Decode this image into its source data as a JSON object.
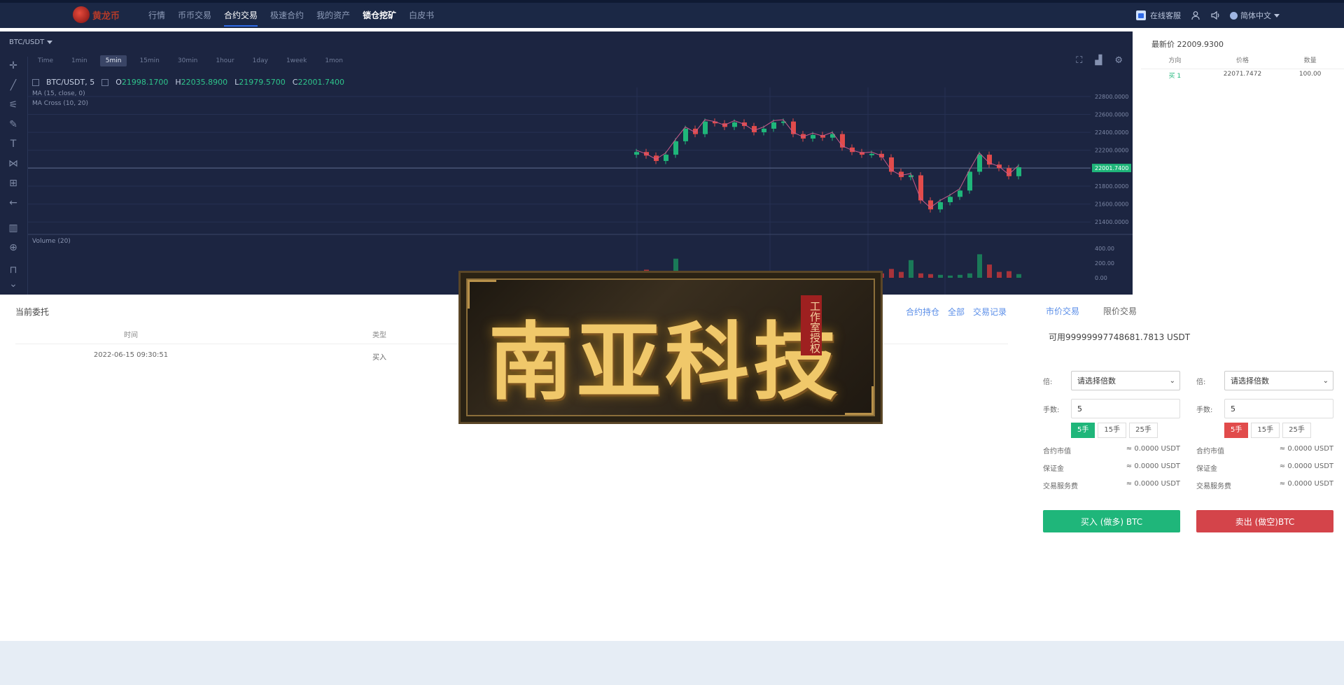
{
  "header": {
    "logo_text": "黄龙币",
    "nav": [
      "行情",
      "币币交易",
      "合约交易",
      "极速合约",
      "我的资产",
      "锁仓挖矿",
      "白皮书"
    ],
    "active_nav": "合约交易",
    "right": {
      "service": "在线客服",
      "language": "简体中文"
    }
  },
  "chart": {
    "pair": "BTC/USDT",
    "intervals": [
      "Time",
      "1min",
      "5min",
      "15min",
      "30min",
      "1hour",
      "1day",
      "1week",
      "1mon"
    ],
    "active_interval": "5min",
    "ohlc_title": "BTC/USDT, 5",
    "o": "21998.1700",
    "h": "22035.8900",
    "l": "21979.5700",
    "c": "22001.7400",
    "ind1": "MA (15, close, 0)",
    "ind2": "MA Cross (10, 20)",
    "vol_label": "Volume (20)"
  },
  "chart_data": {
    "type": "line",
    "title": "BTC/USDT, 5",
    "y_ticks": [
      "22800.0000",
      "22600.0000",
      "22400.0000",
      "22200.0000",
      "22000.0000",
      "21800.0000",
      "21600.0000",
      "21400.0000"
    ],
    "current_price": "22001.7400",
    "vol_ticks": [
      "400.00",
      "200.00",
      "0.00"
    ],
    "x": [
      1,
      2,
      3,
      4,
      5,
      6,
      7,
      8,
      9,
      10,
      11,
      12,
      13,
      14,
      15,
      16,
      17,
      18,
      19,
      20,
      21,
      22,
      23,
      24,
      25,
      26,
      27,
      28,
      29,
      30,
      31,
      32,
      33,
      34,
      35,
      36,
      37,
      38,
      39,
      40
    ],
    "series": [
      {
        "values": [
          22180,
          22140,
          22080,
          22150,
          22300,
          22440,
          22380,
          22520,
          22500,
          22460,
          22510,
          22470,
          22400,
          22440,
          22510,
          22520,
          22380,
          22330,
          22370,
          22340,
          22380,
          22230,
          22180,
          22150,
          22160,
          22120,
          21960,
          21900,
          21920,
          21640,
          21540,
          21620,
          21680,
          21750,
          21960,
          22150,
          22040,
          22000,
          21910,
          22010
        ]
      }
    ],
    "volume": [
      60,
      110,
      40,
      30,
      260,
      40,
      50,
      60,
      30,
      40,
      70,
      50,
      40,
      30,
      60,
      45,
      40,
      50,
      35,
      60,
      30,
      70,
      40,
      50,
      30,
      60,
      120,
      80,
      240,
      60,
      50,
      40,
      30,
      40,
      60,
      320,
      180,
      80,
      90,
      50
    ]
  },
  "orderbook": {
    "latest": "最新价 22009.9300",
    "headers": [
      "方向",
      "价格",
      "数量"
    ],
    "rows": [
      {
        "dir": "买 1",
        "price": "22071.7472",
        "qty": "100.00"
      }
    ]
  },
  "orders": {
    "title": "当前委托",
    "links": [
      "合约持仓",
      "全部",
      "交易记录"
    ],
    "headers": [
      "时间",
      "类型"
    ],
    "rows": [
      {
        "time": "2022-06-15 09:30:51",
        "type": "买入"
      }
    ]
  },
  "trade": {
    "tabs": [
      "市价交易",
      "限价交易"
    ],
    "available": "可用99999997748681.7813 USDT",
    "leverage_label": "倍:",
    "leverage_placeholder": "请选择倍数",
    "qty_label": "手数:",
    "qty_value": "5",
    "lots": [
      "5手",
      "15手",
      "25手"
    ],
    "contract_value_label": "合约市值",
    "contract_value": "≈ 0.0000 USDT",
    "margin_label": "保证金",
    "margin": "≈ 0.0000 USDT",
    "fee_label": "交易服务费",
    "fee": "≈ 0.0000 USDT",
    "buy_btn": "买入 (做多) BTC",
    "sell_btn": "卖出 (做空)BTC"
  },
  "watermark": {
    "text": "南亚科技",
    "stamp": "工作室授权"
  },
  "colors": {
    "up": "#1fb67a",
    "down": "#e14b4b",
    "bg_dark": "#1c2541",
    "accent": "#2f6be8"
  }
}
